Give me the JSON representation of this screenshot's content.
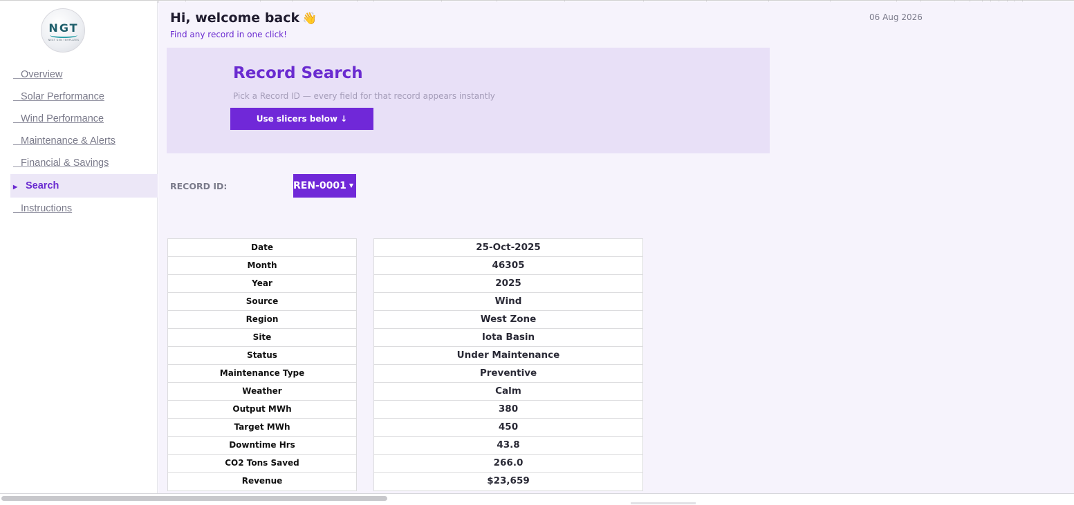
{
  "sidebar": {
    "logo_text": "NGT",
    "logo_subtext": "NEXT GEN TEMPLATES",
    "items": [
      {
        "label": "Overview"
      },
      {
        "label": "Solar Performance"
      },
      {
        "label": "Wind Performance"
      },
      {
        "label": "Maintenance & Alerts"
      },
      {
        "label": "Financial & Savings"
      },
      {
        "label": "Search",
        "active": true
      },
      {
        "label": "Instructions"
      }
    ]
  },
  "header": {
    "greeting": "Hi, welcome back",
    "subtitle": "Find any record in one click!",
    "date": "06 Aug 2026"
  },
  "search_card": {
    "title": "Record Search",
    "description": "Pick a Record ID — every field for that record appears instantly",
    "button_label": "Use slicers below ↓"
  },
  "record_filter": {
    "label": "RECORD ID:",
    "selected": "REN-0001"
  },
  "record": {
    "fields": [
      "Date",
      "Month",
      "Year",
      "Source",
      "Region",
      "Site",
      "Status",
      "Maintenance Type",
      "Weather",
      "Output MWh",
      "Target MWh",
      "Downtime Hrs",
      "CO2 Tons Saved",
      "Revenue"
    ],
    "values": [
      "25-Oct-2025",
      "46305",
      "2025",
      "Wind",
      "West Zone",
      "Iota Basin",
      "Under Maintenance",
      "Preventive",
      "Calm",
      "380",
      "450",
      "43.8",
      "266.0",
      "$23,659"
    ]
  },
  "colors": {
    "accent": "#7028d8",
    "card_bg": "#e8e0f7",
    "page_bg": "#f6f3fc"
  },
  "icons": {
    "wave": "waving-hand-icon",
    "dropdown": "caret-down-icon"
  }
}
